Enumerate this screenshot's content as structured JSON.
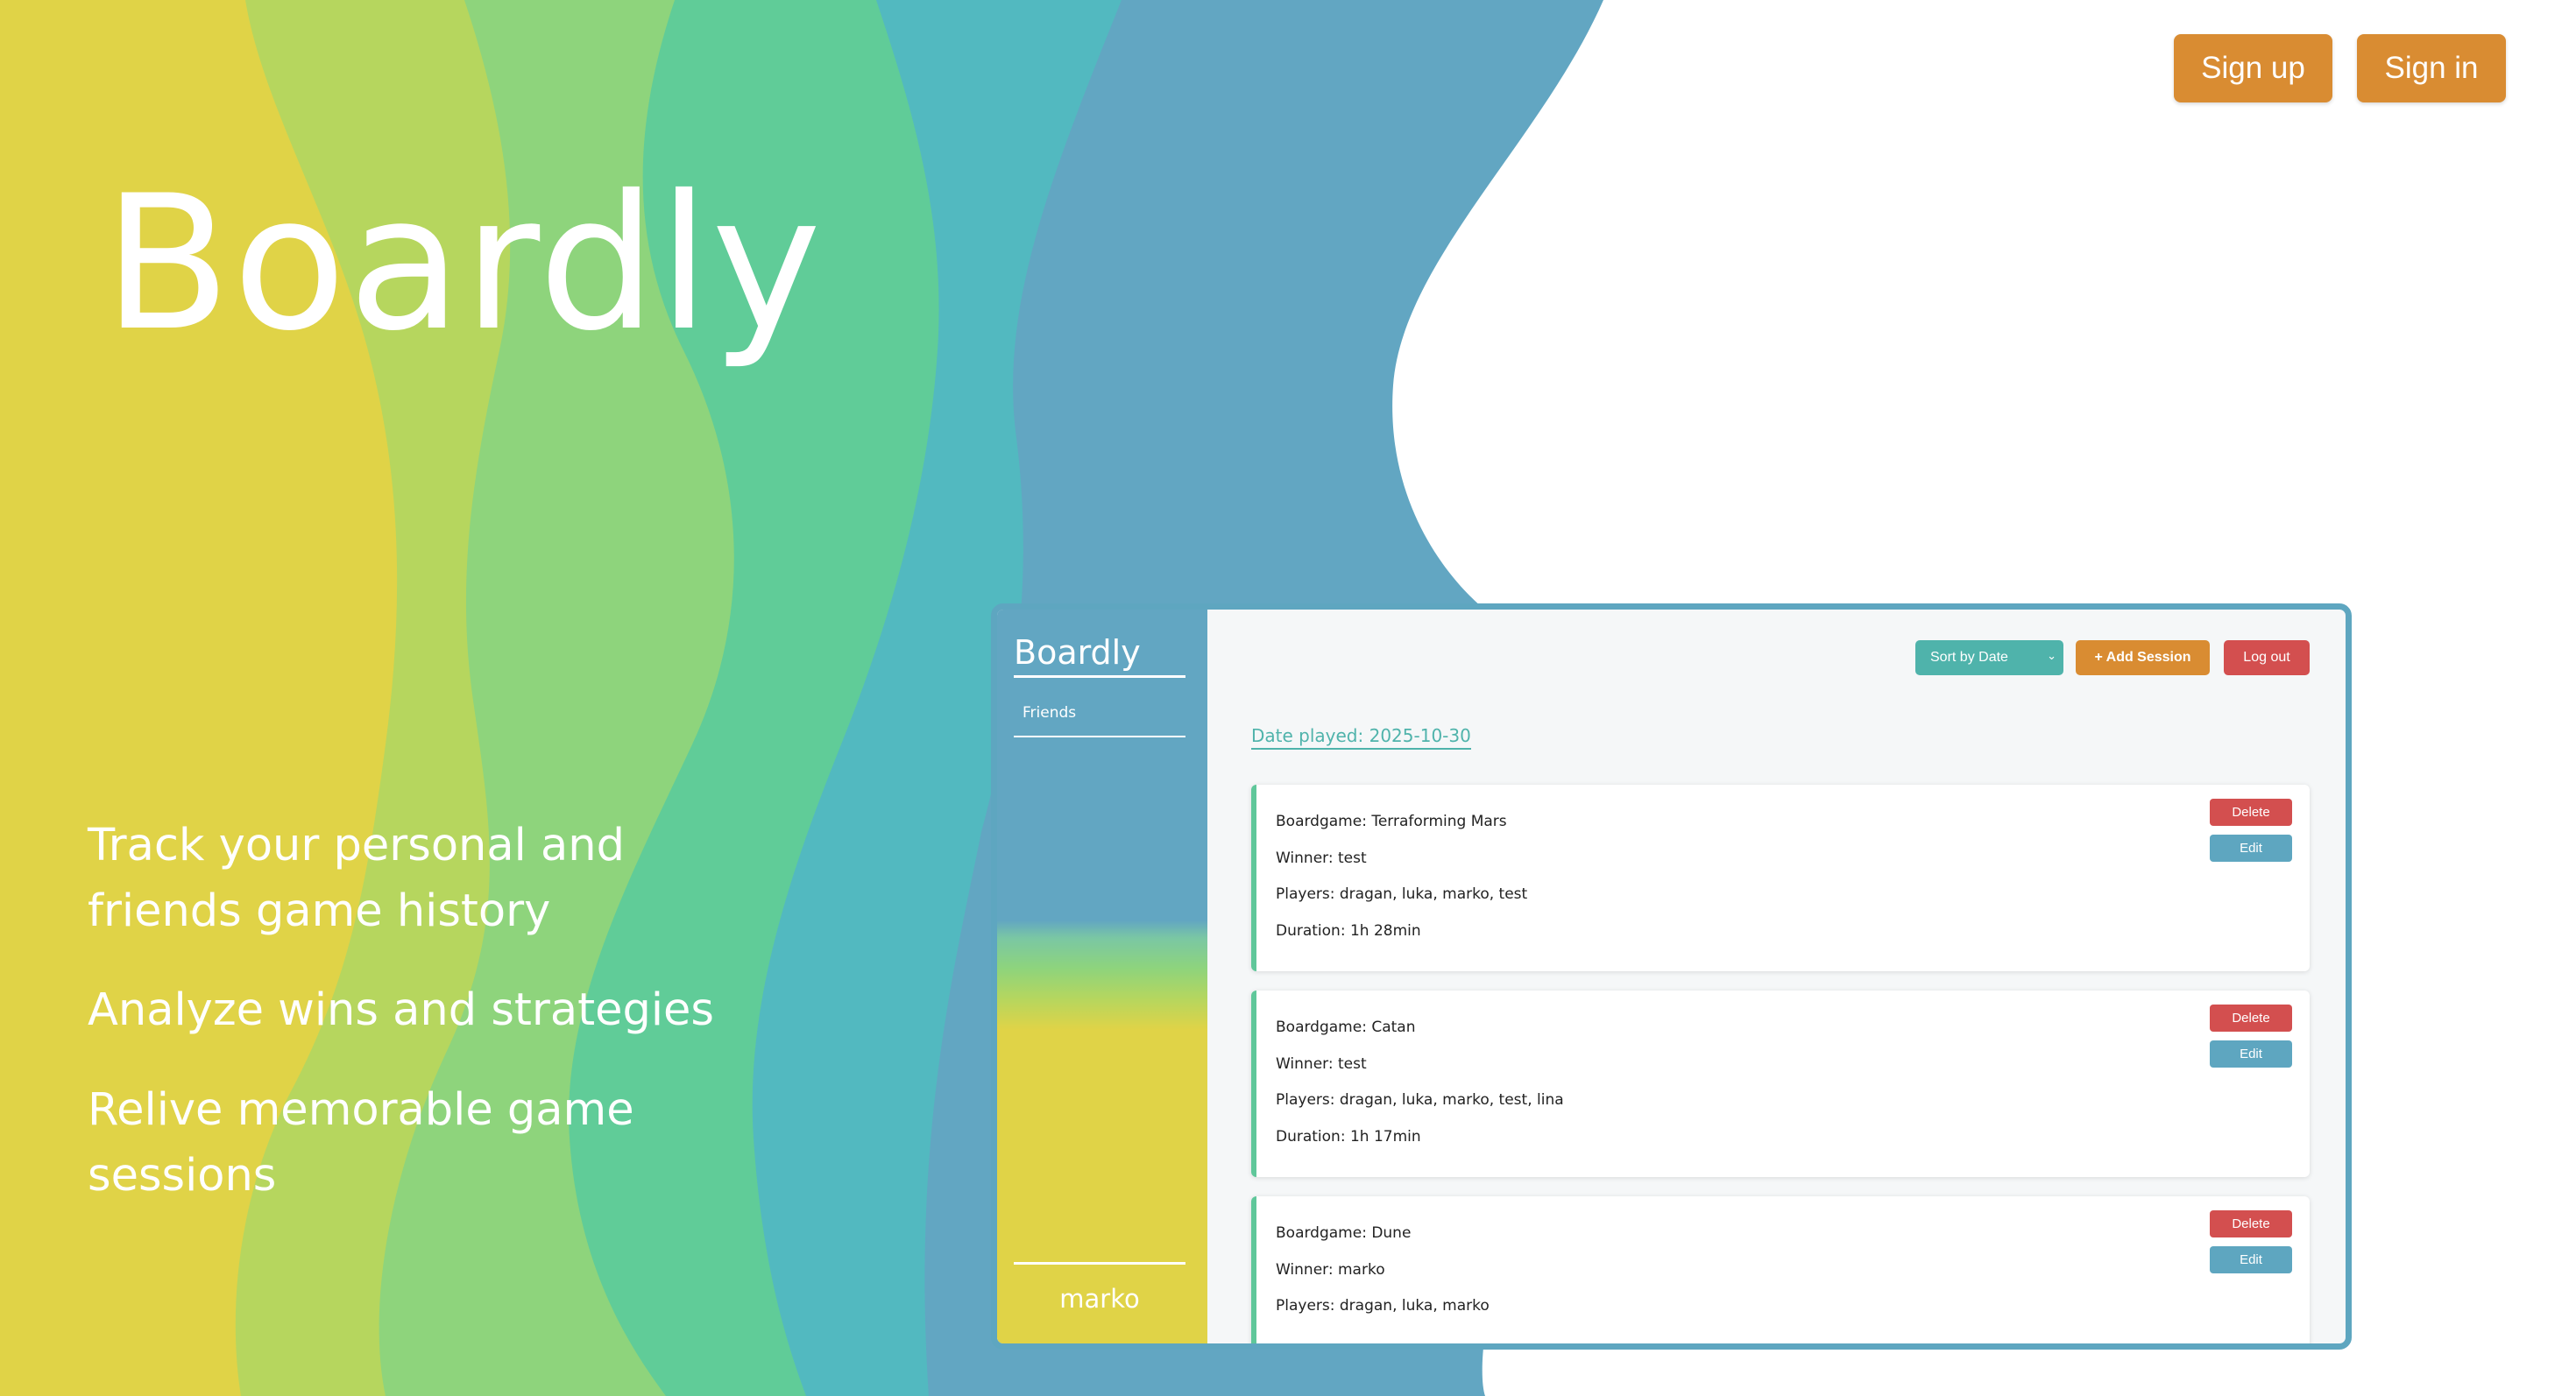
{
  "header": {
    "signup_label": "Sign up",
    "signin_label": "Sign in"
  },
  "hero": {
    "brand": "Boardly",
    "taglines": [
      "Track your personal and friends game history",
      "Analyze wins and strategies",
      "Relive memorable game sessions"
    ]
  },
  "colors": {
    "wave_yellow": "#e0d347",
    "wave_lime": "#b6d65e",
    "wave_green": "#8ed47c",
    "wave_teal": "#60cc98",
    "wave_cyan": "#52b9c0",
    "wave_blue": "#62a6c2",
    "accent_orange": "#d98c32",
    "danger_red": "#d34f4f",
    "card_accent": "#5fc79a"
  },
  "preview": {
    "sidebar": {
      "brand": "Boardly",
      "friends_label": "Friends",
      "user": "marko"
    },
    "toolbar": {
      "sort_label": "Sort by Date",
      "sort_icon": "chevron-down-icon",
      "add_label": "+ Add Session",
      "logout_label": "Log out"
    },
    "date_label": "Date played: 2025-10-30",
    "sessions": [
      {
        "boardgame": "Boardgame: Terraforming Mars",
        "winner": "Winner: test",
        "players": "Players: dragan, luka, marko, test",
        "duration": "Duration: 1h 28min",
        "delete_label": "Delete",
        "edit_label": "Edit"
      },
      {
        "boardgame": "Boardgame: Catan",
        "winner": "Winner: test",
        "players": "Players: dragan, luka, marko, test, lina",
        "duration": "Duration: 1h 17min",
        "delete_label": "Delete",
        "edit_label": "Edit"
      },
      {
        "boardgame": "Boardgame: Dune",
        "winner": "Winner: marko",
        "players": "Players: dragan, luka, marko",
        "duration": "",
        "delete_label": "Delete",
        "edit_label": "Edit"
      }
    ]
  }
}
